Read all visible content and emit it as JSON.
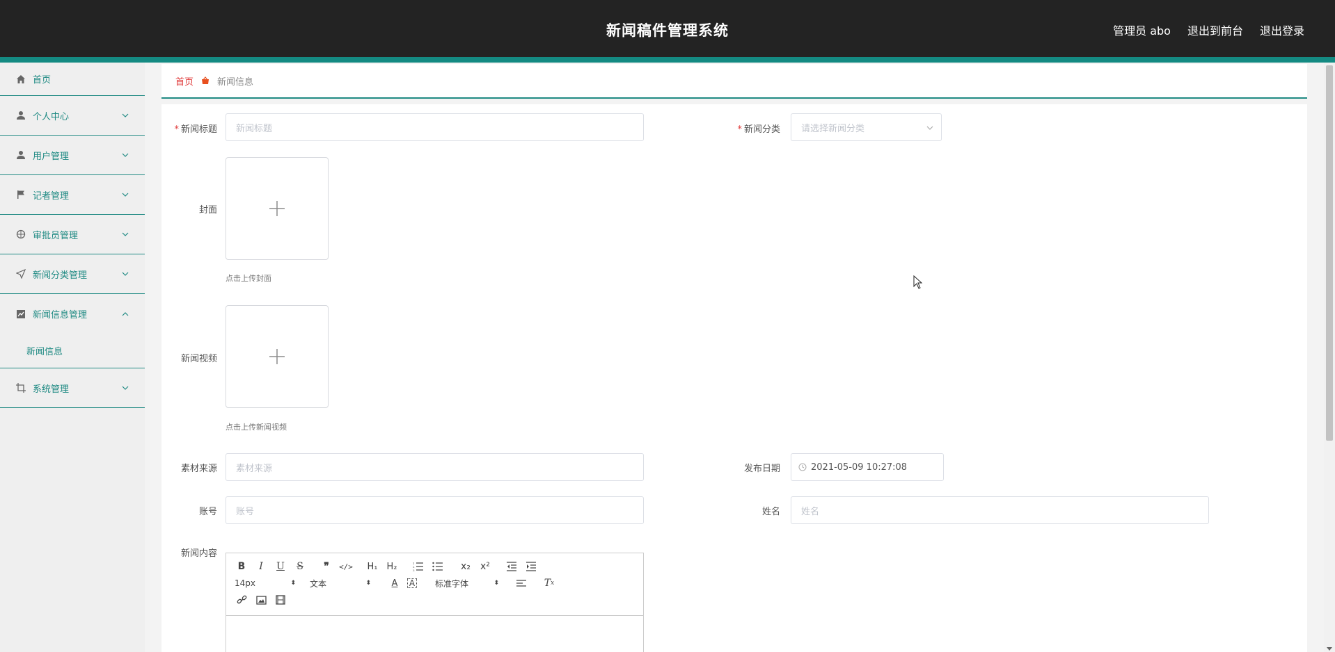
{
  "header": {
    "title": "新闻稿件管理系统",
    "links": [
      "管理员 abo",
      "退出到前台",
      "退出登录"
    ]
  },
  "sidebar": {
    "items": [
      {
        "label": "首页",
        "icon": "home-icon"
      },
      {
        "label": "个人中心",
        "icon": "user-icon"
      },
      {
        "label": "用户管理",
        "icon": "user-icon"
      },
      {
        "label": "记者管理",
        "icon": "flag-icon"
      },
      {
        "label": "审批员管理",
        "icon": "compass-icon"
      },
      {
        "label": "新闻分类管理",
        "icon": "send-icon"
      },
      {
        "label": "新闻信息管理",
        "icon": "chart-icon"
      },
      {
        "label": "系统管理",
        "icon": "crop-icon"
      }
    ],
    "submenu_news": "新闻信息"
  },
  "breadcrumb": {
    "home": "首页",
    "current": "新闻信息"
  },
  "form": {
    "title_label": "新闻标题",
    "title_placeholder": "新闻标题",
    "category_label": "新闻分类",
    "category_placeholder": "请选择新闻分类",
    "cover_label": "封面",
    "cover_hint": "点击上传封面",
    "video_label": "新闻视频",
    "video_hint": "点击上传新闻视频",
    "source_label": "素材来源",
    "source_placeholder": "素材来源",
    "date_label": "发布日期",
    "date_value": "2021-05-09 10:27:08",
    "account_label": "账号",
    "account_placeholder": "账号",
    "name_label": "姓名",
    "name_placeholder": "姓名",
    "content_label": "新闻内容"
  },
  "editor": {
    "font_size": "14px",
    "block_type": "文本",
    "font_family": "标准字体"
  },
  "colors": {
    "accent": "#1f8a83",
    "header_bg": "#232323",
    "required": "#e03b3b"
  }
}
